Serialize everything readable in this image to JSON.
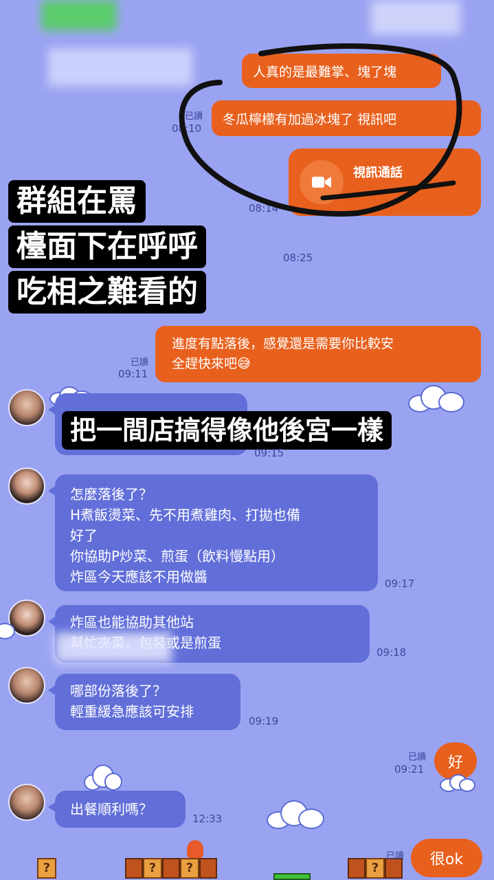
{
  "overlay_caption": {
    "line1": "群組在罵",
    "line2": "檯面下在呼呼",
    "line3": "吃相之難看的"
  },
  "overlay_caption2": "把一間店搞得像他後宮一樣",
  "outgoing": {
    "msg1": "人真的是最難掌、塊了塊",
    "msg2": "冬瓜檸檬有加過冰塊了 視訊吧",
    "msg2_read": "已讀",
    "msg2_time": "08:10",
    "video_call_label": "視訊通話",
    "video_call_time": "08:14",
    "time_0825": "08:25",
    "msg3_line1": "進度有點落後，感覺還是需要你比較安",
    "msg3_line2": "全趕快來吧",
    "msg3_emoji": "😅",
    "msg3_read": "已讀",
    "msg3_time": "09:11",
    "ok_msg": "好",
    "ok_read": "已讀",
    "ok_time": "09:21",
    "veryok_msg": "很ok",
    "veryok_read": "已讀"
  },
  "incoming": {
    "time_0915": "09:15",
    "msg_a_line1": "怎麼落後了？",
    "msg_a_line2": "H煮飯燙菜、先不用煮雞肉、打拋也備",
    "msg_a_line3": "好了",
    "msg_a_line4": "你協助P炒菜、煎蛋（飲料慢點用）",
    "msg_a_line5": "炸區今天應該不用做醬",
    "msg_a_time": "09:17",
    "msg_b_line1": "炸區也能協助其他站",
    "msg_b_line2": "幫忙夾菜、包裝或是煎蛋",
    "msg_b_time": "09:18",
    "msg_c_line1": "哪部份落後了？",
    "msg_c_line2": "輕重緩急應該可安排",
    "msg_c_time": "09:19",
    "msg_d": "出餐順利嗎？",
    "msg_d_time": "12:33"
  },
  "colors": {
    "background": "#9aa3f1",
    "outgoing_bubble": "#e8601d",
    "incoming_bubble": "#626fd9"
  }
}
